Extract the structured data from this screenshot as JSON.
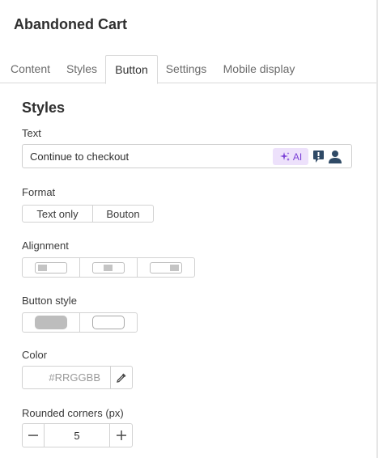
{
  "header": {
    "title": "Abandoned Cart"
  },
  "tabs": [
    {
      "label": "Content"
    },
    {
      "label": "Styles"
    },
    {
      "label": "Button",
      "active": true
    },
    {
      "label": "Settings"
    },
    {
      "label": "Mobile display"
    }
  ],
  "section": {
    "title": "Styles"
  },
  "text_field": {
    "label": "Text",
    "value": "Continue to checkout",
    "ai_label": "AI",
    "icons": [
      "sparkle-icon",
      "personalization-icon",
      "user-icon"
    ]
  },
  "format": {
    "label": "Format",
    "options": [
      "Text only",
      "Bouton"
    ]
  },
  "alignment": {
    "label": "Alignment",
    "options": [
      "align-left-icon",
      "align-center-icon",
      "align-right-icon"
    ]
  },
  "button_style": {
    "label": "Button style",
    "options": [
      "filled-style-icon",
      "outline-style-icon"
    ]
  },
  "color": {
    "label": "Color",
    "placeholder": "#RRGGBB",
    "picker_icon": "eyedropper-icon",
    "accent": "#7a3fd6"
  },
  "rounded_corners": {
    "label": "Rounded corners (px)",
    "value": "5"
  }
}
